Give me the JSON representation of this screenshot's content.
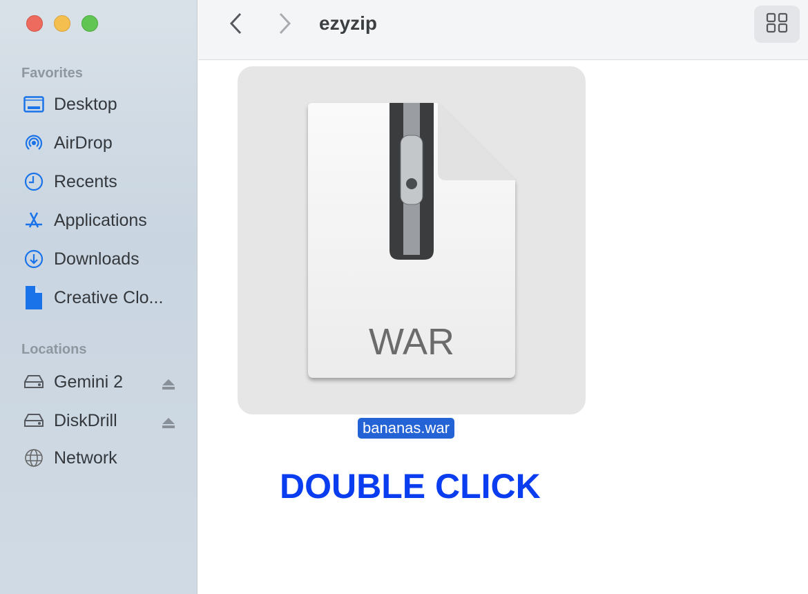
{
  "window": {
    "title": "ezyzip",
    "controls": {
      "close": "#ed6a5e",
      "minimize": "#f5bf4f",
      "zoom": "#61c554"
    }
  },
  "sidebar": {
    "favorites_label": "Favorites",
    "favorites": [
      {
        "label": "Desktop",
        "icon": "desktop-icon"
      },
      {
        "label": "AirDrop",
        "icon": "airdrop-icon"
      },
      {
        "label": "Recents",
        "icon": "clock-icon"
      },
      {
        "label": "Applications",
        "icon": "applications-icon"
      },
      {
        "label": "Downloads",
        "icon": "download-icon"
      },
      {
        "label": "Creative Clo...",
        "icon": "document-icon"
      }
    ],
    "locations_label": "Locations",
    "locations": [
      {
        "label": "Gemini 2",
        "icon": "drive-icon",
        "ejectable": true
      },
      {
        "label": "DiskDrill",
        "icon": "drive-icon",
        "ejectable": true
      },
      {
        "label": "Network",
        "icon": "globe-icon",
        "ejectable": false
      }
    ]
  },
  "file": {
    "name": "bananas.war",
    "type_label": "WAR",
    "selected": true
  },
  "annotation": "DOUBLE CLICK",
  "accent": "#1a73e8"
}
